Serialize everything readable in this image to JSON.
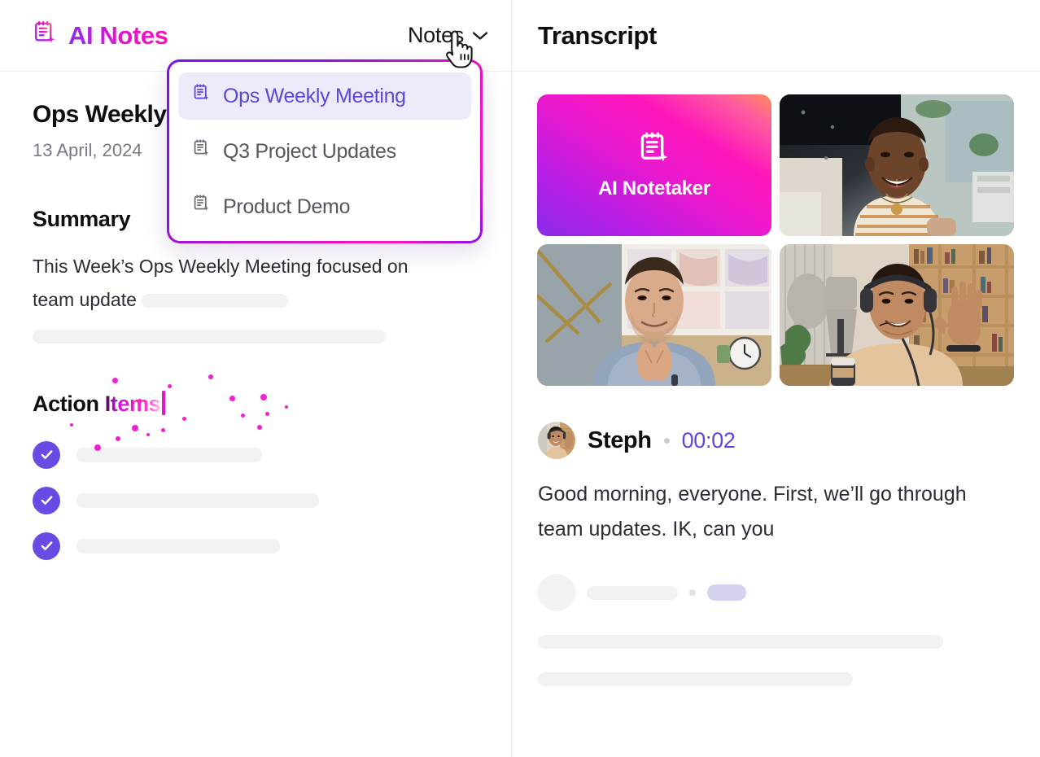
{
  "left": {
    "brand": {
      "icon": "ai-notepad-icon",
      "title": "AI Notes"
    },
    "switcher": {
      "label": "Notes",
      "icon": "chevron-down-icon"
    },
    "dropdown": {
      "items": [
        {
          "label": "Ops Weekly Meeting",
          "icon": "note-sparkle-icon",
          "selected": true
        },
        {
          "label": "Q3 Project Updates",
          "icon": "note-sparkle-icon",
          "selected": false
        },
        {
          "label": "Product Demo",
          "icon": "note-sparkle-icon",
          "selected": false
        }
      ]
    },
    "note": {
      "title": "Ops Weekly Meeting",
      "date": "13 April, 2024"
    },
    "summary": {
      "heading": "Summary",
      "text": "This Week’s Ops Weekly Meeting focused on team update"
    },
    "action_items": {
      "heading_typed": "Action ",
      "heading_generating": "Items",
      "count": 3
    }
  },
  "right": {
    "title": "Transcript",
    "tiles": [
      {
        "name": "AI Notetaker",
        "type": "ai-notetaker",
        "label": "AI Notetaker"
      },
      {
        "name": "participant-woman-office",
        "type": "video"
      },
      {
        "name": "participant-man-blue-shirt",
        "type": "video"
      },
      {
        "name": "participant-man-headphones",
        "type": "video"
      }
    ],
    "transcript": {
      "speaker": "Steph",
      "timestamp": "00:02",
      "separator": "·",
      "text": "Good morning, everyone. First, we’ll go through team updates. IK, can you"
    }
  },
  "colors": {
    "brand_purple": "#8b2fe8",
    "brand_magenta": "#f710b5",
    "accent_indigo": "#5b47e0",
    "check_purple": "#6a4ae4",
    "dropdown_active_bg": "#eceafb",
    "skeleton": "#f2f2f4",
    "skeleton_pill": "#d3d2ef"
  }
}
